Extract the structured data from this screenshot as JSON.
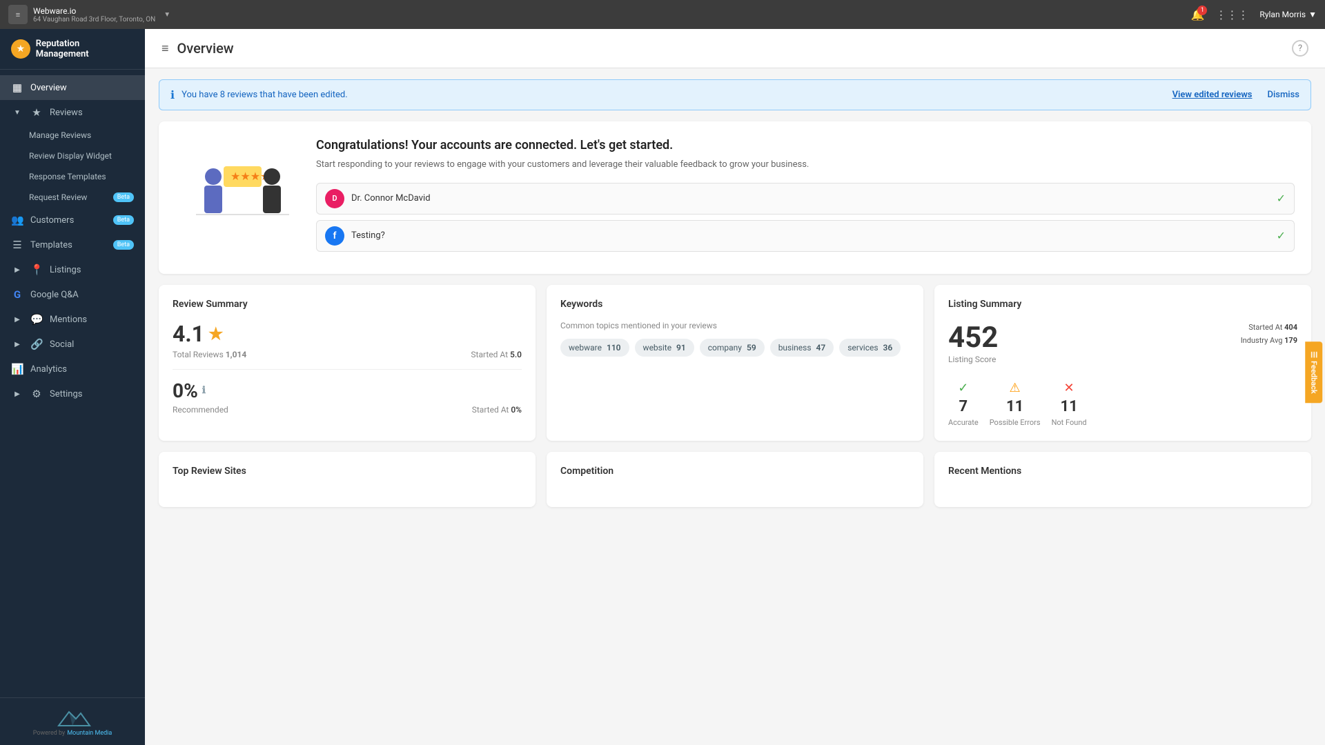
{
  "browser": {
    "icon": "≡",
    "title": "Webware.io",
    "subtitle": "64 Vaughan Road 3rd Floor, Toronto, ON",
    "dropdown": "▼",
    "notification_count": "1",
    "user_name": "Rylan Morris",
    "user_dropdown": "▼"
  },
  "sidebar": {
    "brand_icon": "★",
    "brand_name": "Reputation Management",
    "nav_items": [
      {
        "id": "overview",
        "icon": "▦",
        "label": "Overview",
        "active": true
      },
      {
        "id": "reviews",
        "icon": "★",
        "label": "Reviews",
        "has_arrow": true,
        "expanded": true
      },
      {
        "id": "manage-reviews",
        "label": "Manage Reviews",
        "sub": true
      },
      {
        "id": "review-display-widget",
        "label": "Review Display Widget",
        "sub": true
      },
      {
        "id": "response-templates",
        "label": "Response Templates",
        "sub": true
      },
      {
        "id": "request-review",
        "label": "Request Review",
        "sub": true,
        "badge": "Beta"
      },
      {
        "id": "customers",
        "icon": "👥",
        "label": "Customers",
        "badge": "Beta"
      },
      {
        "id": "templates",
        "icon": "☰",
        "label": "Templates",
        "badge": "Beta"
      },
      {
        "id": "listings",
        "icon": "📍",
        "label": "Listings",
        "has_arrow": true
      },
      {
        "id": "google-qa",
        "icon": "G",
        "label": "Google Q&A"
      },
      {
        "id": "mentions",
        "icon": "💬",
        "label": "Mentions",
        "has_arrow": true
      },
      {
        "id": "social",
        "icon": "🔗",
        "label": "Social",
        "has_arrow": true
      },
      {
        "id": "analytics",
        "icon": "📊",
        "label": "Analytics"
      },
      {
        "id": "settings",
        "icon": "⚙",
        "label": "Settings",
        "has_arrow": true
      }
    ],
    "powered_by": "Powered by",
    "powered_brand": "Mountain Media"
  },
  "header": {
    "menu_icon": "≡",
    "title": "Overview",
    "help_icon": "?"
  },
  "banner": {
    "icon": "ℹ",
    "text": "You have 8 reviews that have been edited.",
    "link_text": "View edited reviews",
    "dismiss_text": "Dismiss"
  },
  "welcome": {
    "title": "Congratulations! Your accounts are connected. Let's get started.",
    "subtitle": "Start responding to your reviews to engage with your customers and leverage their valuable feedback to grow your business.",
    "connections": [
      {
        "id": "dr-connor",
        "initials": "D",
        "name": "Dr. Connor McDavid",
        "connected": true
      },
      {
        "id": "testing",
        "icon": "f",
        "name": "Testing?",
        "connected": true,
        "is_fb": true
      }
    ]
  },
  "review_summary": {
    "card_title": "Review Summary",
    "rating": "4.1",
    "star": "★",
    "total_reviews_label": "Total Reviews",
    "total_reviews_value": "1,014",
    "started_at_label": "Started At",
    "started_at_value": "5.0",
    "recommend_pct": "0%",
    "recommend_info": "ℹ",
    "recommended_label": "Recommended",
    "recommend_started_label": "Started At",
    "recommend_started_value": "0%"
  },
  "keywords": {
    "card_title": "Keywords",
    "subtitle": "Common topics mentioned in your reviews",
    "tags": [
      {
        "word": "webware",
        "count": "110"
      },
      {
        "word": "website",
        "count": "91"
      },
      {
        "word": "company",
        "count": "59"
      },
      {
        "word": "business",
        "count": "47"
      },
      {
        "word": "services",
        "count": "36"
      }
    ]
  },
  "listing_summary": {
    "card_title": "Listing Summary",
    "score": "452",
    "score_label": "Listing Score",
    "started_at_label": "Started At",
    "started_at_value": "404",
    "industry_avg_label": "Industry Avg",
    "industry_avg_value": "179",
    "accurate_count": "7",
    "accurate_label": "Accurate",
    "possible_errors_count": "11",
    "possible_errors_label": "Possible Errors",
    "not_found_count": "11",
    "not_found_label": "Not Found"
  },
  "bottom_cards": {
    "top_review_sites": "Top Review Sites",
    "competition": "Competition",
    "recent_mentions": "Recent Mentions"
  },
  "feedback_tab": "Feedback"
}
